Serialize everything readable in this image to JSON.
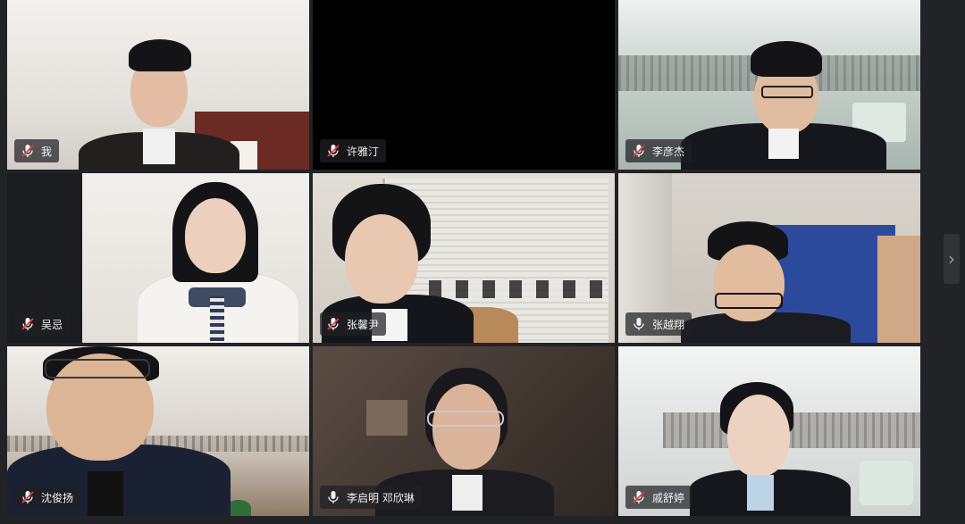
{
  "participants": [
    {
      "name": "我",
      "mic": "muted",
      "bg": "#e9e6e1"
    },
    {
      "name": "许雅汀",
      "mic": "muted",
      "bg": "#000000"
    },
    {
      "name": "李彦杰",
      "mic": "muted",
      "bg": "#c9d3cf"
    },
    {
      "name": "吴忌",
      "mic": "muted",
      "bg": "#e6e3de"
    },
    {
      "name": "张馨尹",
      "mic": "muted",
      "bg": "#d9d3c7"
    },
    {
      "name": "张越翔",
      "mic": "on",
      "bg": "#2c4a9c"
    },
    {
      "name": "沈俊扬",
      "mic": "muted",
      "bg": "#d8d3cb"
    },
    {
      "name": "李启明 邓欣琳",
      "mic": "on",
      "bg": "#4a3e37"
    },
    {
      "name": "戚舒婷",
      "mic": "muted",
      "bg": "#e8eaea"
    }
  ],
  "icons": {
    "muted": "mic-muted-icon",
    "on": "mic-icon",
    "next": "chevron-right-icon"
  },
  "nav": {
    "next_glyph": "›"
  }
}
